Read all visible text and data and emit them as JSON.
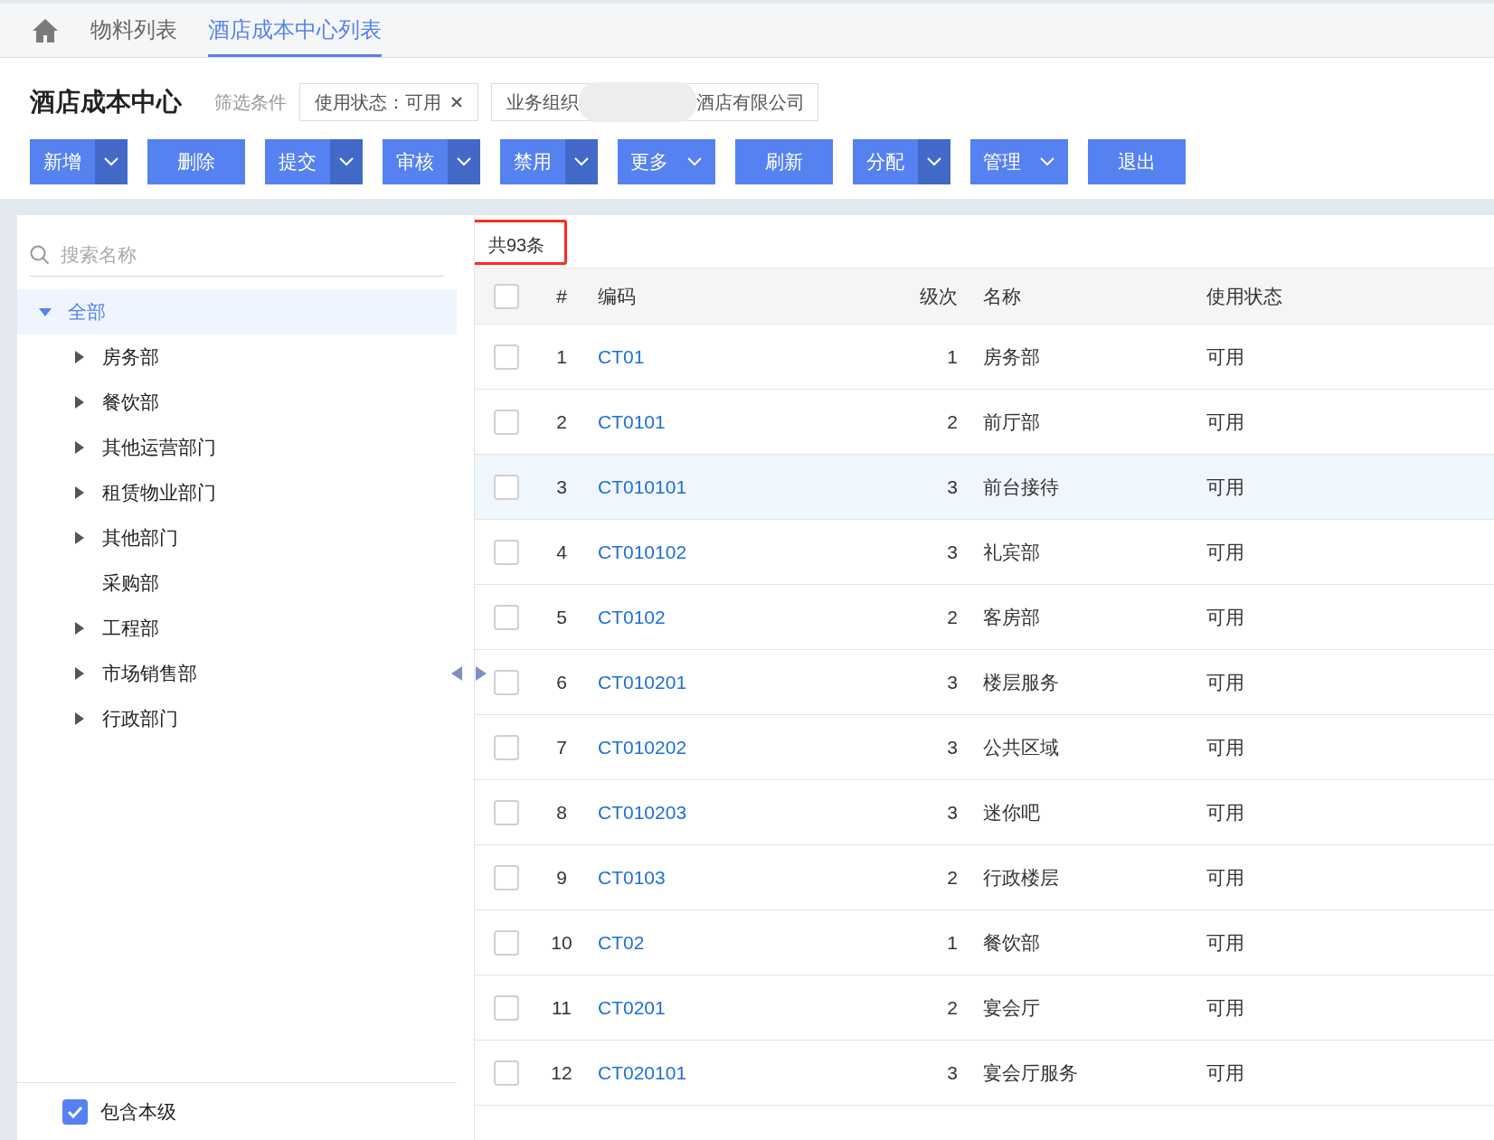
{
  "tabs": [
    {
      "label": "物料列表",
      "selected": false
    },
    {
      "label": "酒店成本中心列表",
      "selected": true
    }
  ],
  "page_title": "酒店成本中心",
  "filter_label": "筛选条件",
  "filters": [
    {
      "kind": "removable",
      "text": "使用状态：可用"
    },
    {
      "kind": "masked",
      "text": "业务组织",
      "text_after": "酒店有限公司"
    }
  ],
  "buttons": [
    {
      "label": "新增",
      "kind": "split"
    },
    {
      "label": "删除",
      "kind": "plain"
    },
    {
      "label": "提交",
      "kind": "split"
    },
    {
      "label": "审核",
      "kind": "split"
    },
    {
      "label": "禁用",
      "kind": "split"
    },
    {
      "label": "更多",
      "kind": "menu"
    },
    {
      "label": "刷新",
      "kind": "plain"
    },
    {
      "label": "分配",
      "kind": "split"
    },
    {
      "label": "管理",
      "kind": "menu"
    },
    {
      "label": "退出",
      "kind": "plain"
    }
  ],
  "tree": {
    "search": {
      "placeholder": "搜索名称"
    },
    "items": [
      {
        "label": "全部",
        "selected": true,
        "expanded": true,
        "children": [
          {
            "label": "房务部",
            "expandable": true
          },
          {
            "label": "餐饮部",
            "expandable": true
          },
          {
            "label": "其他运营部门",
            "expandable": true
          },
          {
            "label": "租赁物业部门",
            "expandable": true
          },
          {
            "label": "其他部门",
            "expandable": true
          },
          {
            "label": "采购部",
            "expandable": false
          },
          {
            "label": "工程部",
            "expandable": true
          },
          {
            "label": "市场销售部",
            "expandable": true
          },
          {
            "label": "行政部门",
            "expandable": true
          }
        ]
      }
    ],
    "include_self": {
      "label": "包含本级",
      "checked": true
    }
  },
  "table": {
    "total": "共93条",
    "columns": [
      "#",
      "编码",
      "级次",
      "名称",
      "使用状态"
    ],
    "header_checked": false,
    "rows": [
      {
        "index": "1",
        "code": "CT01",
        "level_no": "1",
        "name": "房务部",
        "status": "可用",
        "checked": false,
        "selected": false
      },
      {
        "index": "2",
        "code": "CT0101",
        "level_no": "2",
        "name": "前厅部",
        "status": "可用",
        "checked": false,
        "selected": false
      },
      {
        "index": "3",
        "code": "CT010101",
        "level_no": "3",
        "name": "前台接待",
        "status": "可用",
        "checked": false,
        "selected": true
      },
      {
        "index": "4",
        "code": "CT010102",
        "level_no": "3",
        "name": "礼宾部",
        "status": "可用",
        "checked": false,
        "selected": false
      },
      {
        "index": "5",
        "code": "CT0102",
        "level_no": "2",
        "name": "客房部",
        "status": "可用",
        "checked": false,
        "selected": false
      },
      {
        "index": "6",
        "code": "CT010201",
        "level_no": "3",
        "name": "楼层服务",
        "status": "可用",
        "checked": false,
        "selected": false
      },
      {
        "index": "7",
        "code": "CT010202",
        "level_no": "3",
        "name": "公共区域",
        "status": "可用",
        "checked": false,
        "selected": false
      },
      {
        "index": "8",
        "code": "CT010203",
        "level_no": "3",
        "name": "迷你吧",
        "status": "可用",
        "checked": false,
        "selected": false
      },
      {
        "index": "9",
        "code": "CT0103",
        "level_no": "2",
        "name": "行政楼层",
        "status": "可用",
        "checked": false,
        "selected": false
      },
      {
        "index": "10",
        "code": "CT02",
        "level_no": "1",
        "name": "餐饮部",
        "status": "可用",
        "checked": false,
        "selected": false
      },
      {
        "index": "11",
        "code": "CT0201",
        "level_no": "2",
        "name": "宴会厅",
        "status": "可用",
        "checked": false,
        "selected": false
      },
      {
        "index": "12",
        "code": "CT020101",
        "level_no": "3",
        "name": "宴会厅服务",
        "status": "可用",
        "checked": false,
        "selected": false
      }
    ]
  }
}
